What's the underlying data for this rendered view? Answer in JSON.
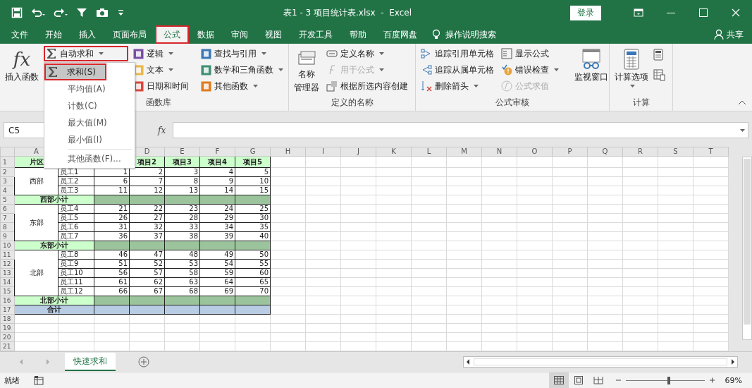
{
  "title_bar": {
    "title": "表1 - 3 项目统计表.xlsx  -  Excel",
    "login": "登录"
  },
  "menu_tabs": [
    {
      "label": "文件",
      "selected": false,
      "outlined": false
    },
    {
      "label": "开始",
      "selected": false,
      "outlined": false
    },
    {
      "label": "插入",
      "selected": false,
      "outlined": false
    },
    {
      "label": "页面布局",
      "selected": false,
      "outlined": false
    },
    {
      "label": "公式",
      "selected": true,
      "outlined": true
    },
    {
      "label": "数据",
      "selected": false,
      "outlined": false
    },
    {
      "label": "审阅",
      "selected": false,
      "outlined": false
    },
    {
      "label": "视图",
      "selected": false,
      "outlined": false
    },
    {
      "label": "开发工具",
      "selected": false,
      "outlined": false
    },
    {
      "label": "帮助",
      "selected": false,
      "outlined": false
    },
    {
      "label": "百度网盘",
      "selected": false,
      "outlined": false
    }
  ],
  "tell_me": "操作说明搜索",
  "share": "共享",
  "ribbon": {
    "insert_function": {
      "glyph": "fx",
      "label": "插入函数"
    },
    "autosum": {
      "label": "自动求和",
      "outlined": true
    },
    "function_columns": [
      [
        {
          "label": "逻辑",
          "color": "#7b4ea3"
        },
        {
          "label": "文本",
          "color": "#e8b84a"
        },
        {
          "label": "日期和时间",
          "color": "#d9473c"
        }
      ],
      [
        {
          "label": "查找与引用",
          "color": "#3b78b5"
        },
        {
          "label": "数学和三角函数",
          "color": "#3f8f76"
        },
        {
          "label": "其他函数",
          "color": "#e07b1f"
        }
      ]
    ],
    "function_library_label": "函数库",
    "name_manager": [
      "名称",
      "管理器"
    ],
    "name_items": [
      {
        "label": "定义名称",
        "disabled": false,
        "dropdown": true
      },
      {
        "label": "用于公式",
        "disabled": true,
        "dropdown": true
      },
      {
        "label": "根据所选内容创建",
        "disabled": false,
        "dropdown": false
      }
    ],
    "names_label": "定义的名称",
    "audit_columns": [
      [
        {
          "label": "追踪引用单元格",
          "disabled": false,
          "dropdown": false
        },
        {
          "label": "追踪从属单元格",
          "disabled": false,
          "dropdown": false
        },
        {
          "label": "删除箭头",
          "disabled": false,
          "dropdown": true
        }
      ],
      [
        {
          "label": "显示公式",
          "disabled": false,
          "dropdown": false
        },
        {
          "label": "错误检查",
          "disabled": false,
          "dropdown": true
        },
        {
          "label": "公式求值",
          "disabled": true,
          "dropdown": false
        }
      ]
    ],
    "watch_window": "监视窗口",
    "audit_label": "公式审核",
    "calc_options": "计算选项",
    "calc_label": "计算"
  },
  "autosum_menu": [
    {
      "label": "求和(S)",
      "selected": true,
      "outlined": true,
      "separator_before": false
    },
    {
      "label": "平均值(A)",
      "selected": false,
      "outlined": false,
      "separator_before": false
    },
    {
      "label": "计数(C)",
      "selected": false,
      "outlined": false,
      "separator_before": false
    },
    {
      "label": "最大值(M)",
      "selected": false,
      "outlined": false,
      "separator_before": false
    },
    {
      "label": "最小值(I)",
      "selected": false,
      "outlined": false,
      "separator_before": false
    },
    {
      "label": "其他函数(F)...",
      "selected": false,
      "outlined": false,
      "separator_before": true
    }
  ],
  "formula_bar": {
    "name_box": "C5",
    "fx": "fx"
  },
  "sheet": {
    "column_headers": [
      "A",
      "D",
      "E",
      "F",
      "G",
      "H",
      "I",
      "J",
      "K",
      "L",
      "M",
      "N",
      "O",
      "P",
      "Q",
      "R",
      "S",
      "T"
    ],
    "row_headers": [
      "1",
      "2",
      "3",
      "4",
      "5",
      "6",
      "7",
      "8",
      "9",
      "10",
      "11",
      "12",
      "13",
      "14",
      "15",
      "16",
      "17",
      "18",
      "19",
      "20",
      "21"
    ],
    "header_first": "片区",
    "header_rest": [
      "项目2",
      "项目3",
      "项目4",
      "项目5"
    ],
    "groups": [
      {
        "region": "西部",
        "subtotal": "西部小计",
        "rows": [
          {
            "name": "员工1",
            "values": [
              "1",
              "2",
              "3",
              "4",
              "5"
            ]
          },
          {
            "name": "员工2",
            "values": [
              "6",
              "7",
              "8",
              "9",
              "10"
            ]
          },
          {
            "name": "员工3",
            "values": [
              "11",
              "12",
              "13",
              "14",
              "15"
            ]
          }
        ]
      },
      {
        "region": "东部",
        "subtotal": "东部小计",
        "rows": [
          {
            "name": "员工4",
            "values": [
              "21",
              "22",
              "23",
              "24",
              "25"
            ]
          },
          {
            "name": "员工5",
            "values": [
              "26",
              "27",
              "28",
              "29",
              "30"
            ]
          },
          {
            "name": "员工6",
            "values": [
              "31",
              "32",
              "33",
              "34",
              "35"
            ]
          },
          {
            "name": "员工7",
            "values": [
              "36",
              "37",
              "38",
              "39",
              "40"
            ]
          }
        ]
      },
      {
        "region": "北部",
        "subtotal": "北部小计",
        "rows": [
          {
            "name": "员工8",
            "values": [
              "46",
              "47",
              "48",
              "49",
              "50"
            ]
          },
          {
            "name": "员工9",
            "values": [
              "51",
              "52",
              "53",
              "54",
              "55"
            ]
          },
          {
            "name": "员工10",
            "values": [
              "56",
              "57",
              "58",
              "59",
              "60"
            ]
          },
          {
            "name": "员工11",
            "values": [
              "61",
              "62",
              "63",
              "64",
              "65"
            ]
          },
          {
            "name": "员工12",
            "values": [
              "66",
              "67",
              "68",
              "69",
              "70"
            ]
          }
        ]
      }
    ],
    "total": "合计"
  },
  "sheet_tabs": [
    {
      "label": "快速求和",
      "selected": true
    }
  ],
  "status_bar": {
    "status": "就绪",
    "zoom": "69%",
    "level": 0.55
  }
}
